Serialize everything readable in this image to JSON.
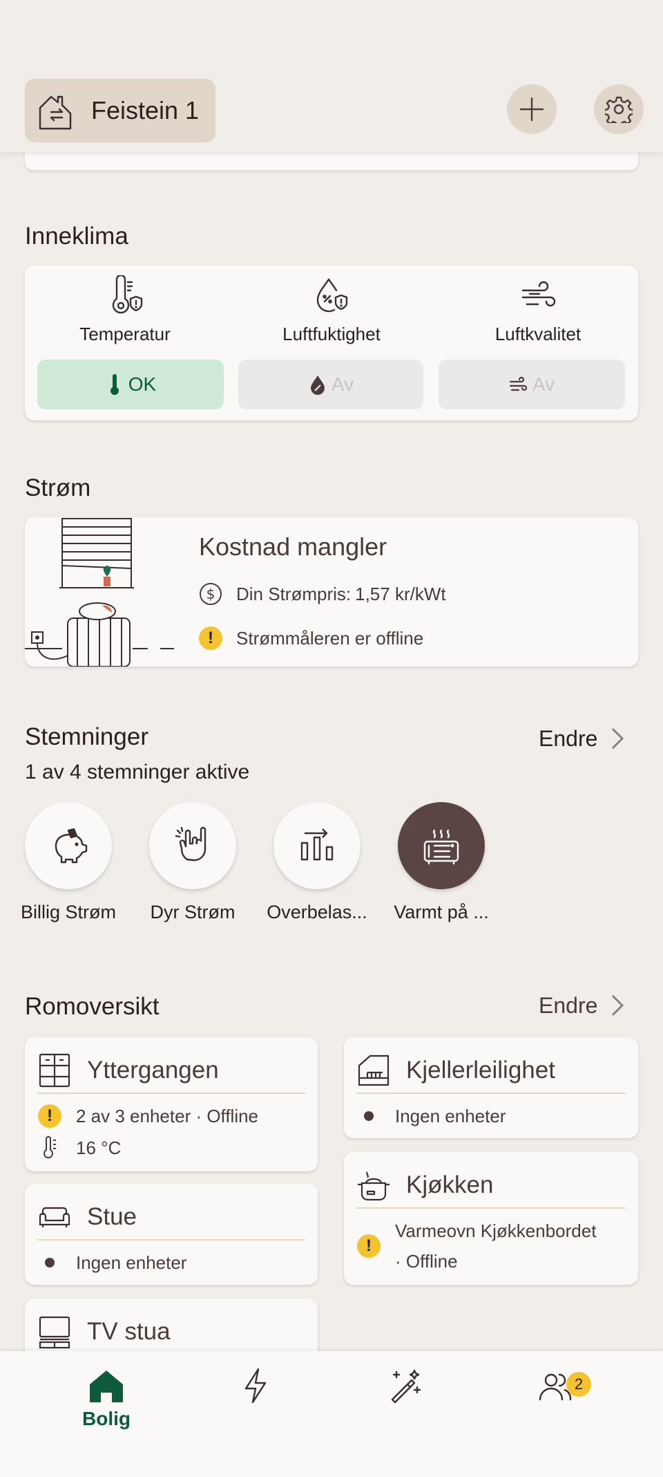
{
  "header": {
    "home_name": "Feistein 1",
    "add_icon": "plus-icon",
    "settings_icon": "gear-icon"
  },
  "indoor_climate": {
    "title": "Inneklima",
    "items": [
      {
        "label": "Temperatur",
        "status": "OK",
        "state": "ok",
        "icon": "thermometer-shield-icon"
      },
      {
        "label": "Luftfuktighet",
        "status": "Av",
        "state": "off",
        "icon": "droplet-shield-icon"
      },
      {
        "label": "Luftkvalitet",
        "status": "Av",
        "state": "off",
        "icon": "wind-icon"
      }
    ]
  },
  "power": {
    "title": "Strøm",
    "card_title": "Kostnad mangler",
    "price_label": "Din Strømpris: ",
    "price_value": "1,57 kr/kWt",
    "meter_status": "Strømmåleren er offline"
  },
  "scenes": {
    "title": "Stemninger",
    "edit_label": "Endre",
    "subtitle": "1 av 4 stemninger aktive",
    "items": [
      {
        "label": "Billig Strøm",
        "icon": "piggy-bank-icon",
        "active": false
      },
      {
        "label": "Dyr Strøm",
        "icon": "hand-sign-icon",
        "active": false
      },
      {
        "label": "Overbelas...",
        "icon": "load-balance-icon",
        "active": false
      },
      {
        "label": "Varmt på ...",
        "icon": "heater-icon",
        "active": true
      }
    ]
  },
  "rooms": {
    "title": "Romoversikt",
    "edit_label": "Endre",
    "items": [
      {
        "name": "Yttergangen",
        "icon": "cabinet-icon",
        "status": "2 av 3 enheter · Offline",
        "temp": "16 °C"
      },
      {
        "name": "Kjellerleilighet",
        "icon": "basement-icon",
        "status": "Ingen enheter"
      },
      {
        "name": "Stue",
        "icon": "sofa-icon",
        "status": "Ingen enheter"
      },
      {
        "name": "Kjøkken",
        "icon": "pot-icon",
        "status_line1": "Varmeovn Kjøkkenbordet",
        "status_line2": "· Offline"
      },
      {
        "name": "TV stua",
        "icon": "tv-icon"
      }
    ]
  },
  "bottom_nav": {
    "items": [
      {
        "label": "Bolig",
        "icon": "home-icon",
        "active": true
      },
      {
        "label": "",
        "icon": "lightning-icon",
        "active": false
      },
      {
        "label": "",
        "icon": "magic-wand-icon",
        "active": false
      },
      {
        "label": "",
        "icon": "people-icon",
        "active": false,
        "badge": "2"
      }
    ]
  },
  "colors": {
    "background": "#f1eeea",
    "accent_green": "#0e5a3c",
    "ok_bg": "#cfe9d7",
    "warning": "#f4c430",
    "active_scene": "#5a4542"
  }
}
